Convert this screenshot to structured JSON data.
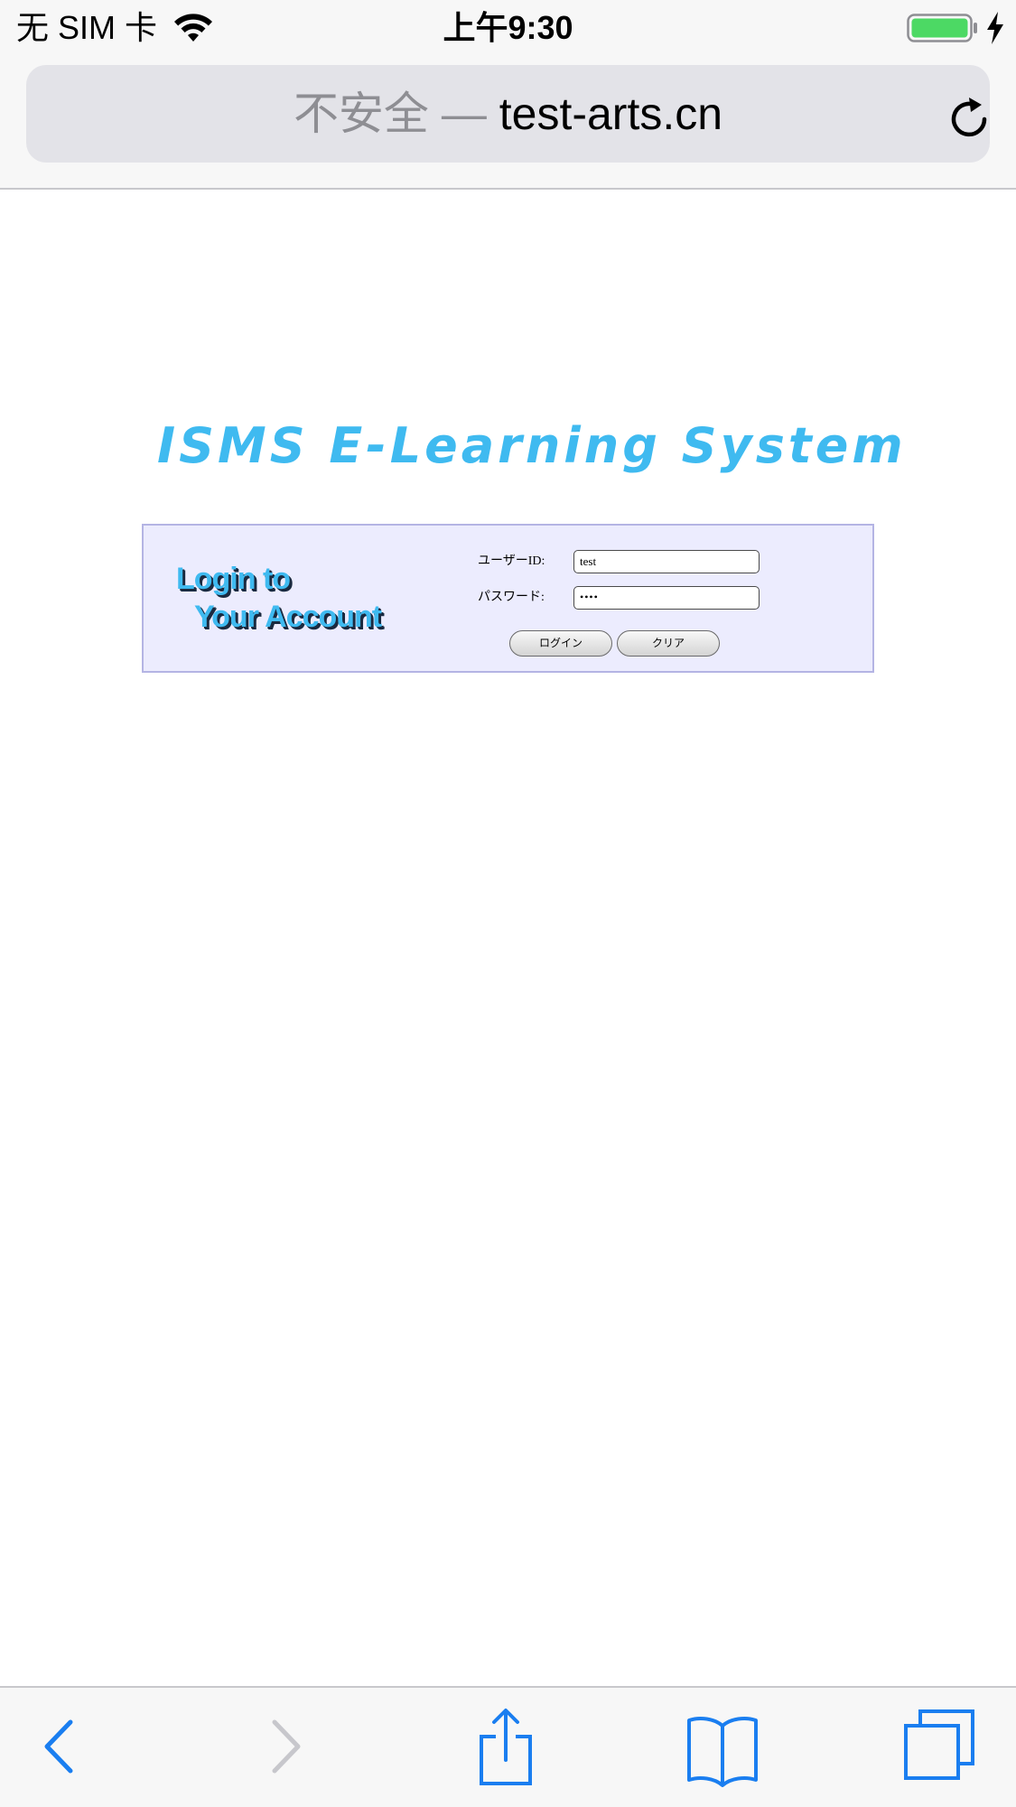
{
  "status_bar": {
    "carrier": "无 SIM 卡",
    "time": "上午9:30",
    "icons": [
      "wifi-icon",
      "battery-icon",
      "charging-icon"
    ],
    "battery_color": "#4cd964"
  },
  "address_bar": {
    "security_label": "不安全 —",
    "domain": "test-arts.cn",
    "reload_icon": "reload-icon"
  },
  "page": {
    "title": "ISMS  E-Learning  System",
    "title_color": "#3fbaf0",
    "login_heading_line1": "Login to",
    "login_heading_line2": "Your Account",
    "panel_background": "#ececfe",
    "form": {
      "userid_label": "ユーザーID:",
      "userid_value": "test",
      "password_label": "パスワード:",
      "password_value": "••••",
      "login_button": "ログイン",
      "clear_button": "クリア"
    }
  },
  "toolbar": {
    "items": [
      "back-icon",
      "forward-icon",
      "share-icon",
      "bookmarks-icon",
      "tabs-icon"
    ],
    "accent_color": "#1a7ef0",
    "disabled_color": "#c7c7cc"
  }
}
